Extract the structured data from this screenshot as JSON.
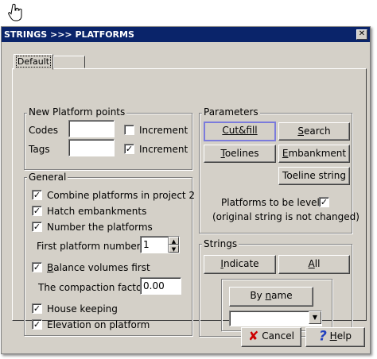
{
  "window": {
    "title": "STRINGS >>> PLATFORMS",
    "close_glyph": "✕"
  },
  "cursor": {
    "icon": "hand-pointer-icon"
  },
  "tabs": [
    {
      "label": "Default",
      "active": true
    },
    {
      "label": "",
      "active": false
    }
  ],
  "new_platform_points": {
    "legend": "New Platform points",
    "codes_label": "Codes",
    "codes_value": "",
    "tags_label": "Tags",
    "tags_value": "",
    "codes_increment": {
      "label": "Increment",
      "checked": false,
      "glyph": ""
    },
    "tags_increment": {
      "label": "Increment",
      "checked": true,
      "glyph": "✓"
    }
  },
  "general": {
    "legend": "General",
    "combine": {
      "label": "Combine platforms in project 2",
      "glyph": "✓"
    },
    "hatch": {
      "label": "Hatch embankments",
      "glyph": "✓"
    },
    "number": {
      "label": "Number the platforms",
      "glyph": "✓"
    },
    "first_number_label": "First platform number :",
    "first_number_value": "1",
    "balance": {
      "label_underlined": "B",
      "label_rest": "alance volumes first",
      "glyph": "✓"
    },
    "compaction_label": "The compaction factor",
    "compaction_value": "0.00",
    "housekeeping": {
      "label": "House keeping",
      "glyph": "✓"
    },
    "elevation": {
      "label": "Elevation on platform",
      "glyph": "✓"
    }
  },
  "parameters": {
    "legend": "Parameters",
    "cutfill": "Cut&fill",
    "search_u": "S",
    "search_rest": "earch",
    "toelines_u": "T",
    "toelines_rest": "oelines",
    "embankment_u": "E",
    "embankment_rest": "mbankment",
    "toeline_string": "Toeline string",
    "level_label": "Platforms to be level",
    "level_glyph": "✓",
    "level_note": "(original string is not changed)"
  },
  "strings": {
    "legend": "Strings",
    "indicate_u": "I",
    "indicate_rest": "ndicate",
    "all_u": "A",
    "all_rest": "ll",
    "byname_pre": "By ",
    "byname_u": "n",
    "byname_rest": "ame",
    "select_value": ""
  },
  "footer": {
    "cancel": "Cancel",
    "help_u": "H",
    "help_rest": "elp",
    "cancel_color": "#cc0000",
    "help_color": "#1f3fbf"
  }
}
